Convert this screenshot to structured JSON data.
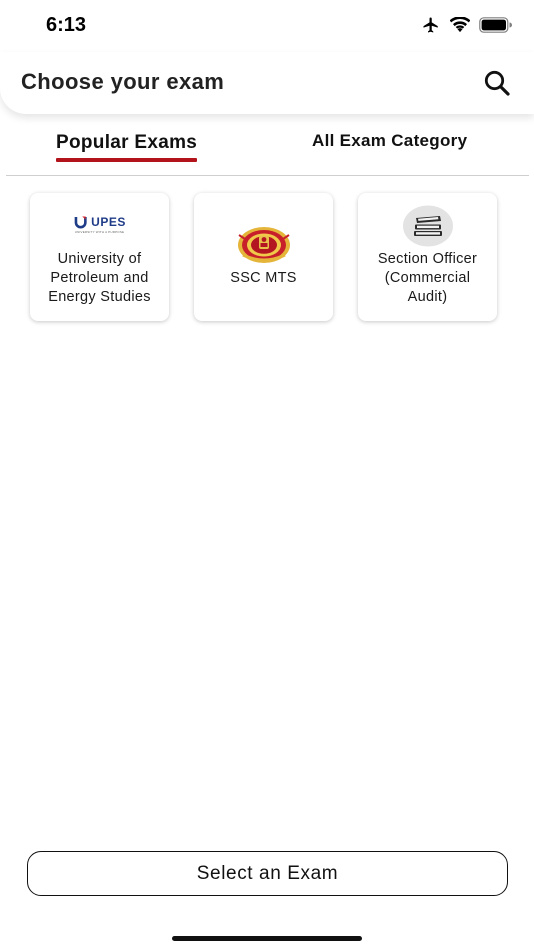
{
  "status_bar": {
    "time": "6:13",
    "icons": [
      "airplane-icon",
      "wifi-icon",
      "battery-icon"
    ]
  },
  "header": {
    "title": "Choose your exam",
    "search_icon": "search-icon"
  },
  "tabs": [
    {
      "label": "Popular Exams",
      "active": true
    },
    {
      "label": "All Exam Category",
      "active": false
    }
  ],
  "exams": [
    {
      "label": "University of Petroleum and Energy Studies",
      "logo": "upes-logo",
      "logo_text": "UPES",
      "logo_tagline": "UNIVERSITY WITH A PURPOSE"
    },
    {
      "label": "SSC MTS",
      "logo": "ssc-emblem-icon"
    },
    {
      "label": "Section Officer (Commercial Audit)",
      "logo": "books-icon"
    }
  ],
  "footer": {
    "select_button_label": "Select an Exam"
  },
  "colors": {
    "accent": "#b3141b",
    "upes_blue": "#1f3c88",
    "upes_red": "#d4252d",
    "text": "#111111",
    "background": "#ffffff"
  }
}
